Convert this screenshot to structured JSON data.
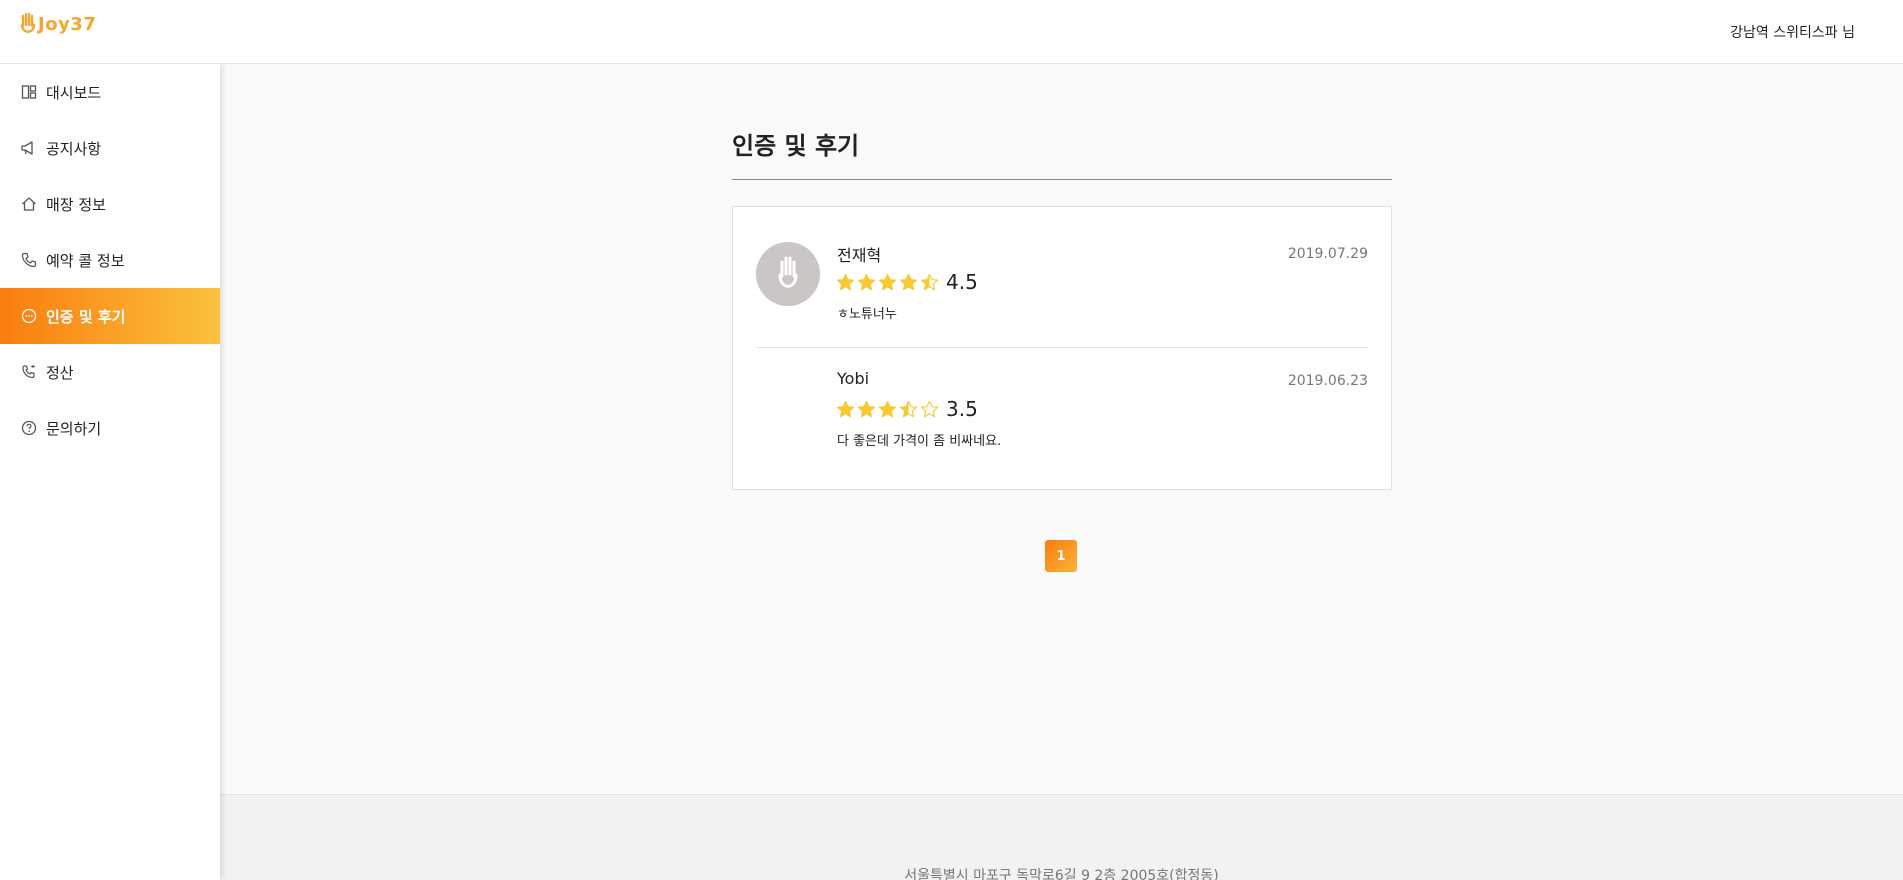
{
  "header": {
    "logo_text": "Joy37",
    "user_name": "강남역 스위티스파 님",
    "brand_color": "#f7a531"
  },
  "sidebar": {
    "items": [
      {
        "label": "대시보드",
        "icon": "dashboard-icon"
      },
      {
        "label": "공지사항",
        "icon": "megaphone-icon"
      },
      {
        "label": "매장 정보",
        "icon": "home-icon"
      },
      {
        "label": "예약 콜 정보",
        "icon": "phone-icon"
      },
      {
        "label": "인증 및 후기",
        "icon": "chat-bubble-icon",
        "active": true
      },
      {
        "label": "정산",
        "icon": "settlement-icon"
      },
      {
        "label": "문의하기",
        "icon": "question-icon"
      }
    ],
    "active_gradient": [
      "#f97d0e",
      "#fbc13f"
    ]
  },
  "main": {
    "title": "인증 및 후기",
    "reviews": [
      {
        "name": "전재혁",
        "date": "2019.07.29",
        "rating": 4.5,
        "rating_text": "4.5",
        "text": "ㅎ노튜너누",
        "has_avatar": true
      },
      {
        "name": "Yobi",
        "date": "2019.06.23",
        "rating": 3.5,
        "rating_text": "3.5",
        "text": "다 좋은데 가격이 좀 비싸네요.",
        "has_avatar": false
      }
    ],
    "pagination": {
      "current": "1"
    }
  },
  "footer": {
    "address": "서울특별시 마포구 독막로6길 9 2층 2005호(합정동)"
  },
  "colors": {
    "star": "#f8c933",
    "star_empty_stroke": "#f8c933"
  }
}
